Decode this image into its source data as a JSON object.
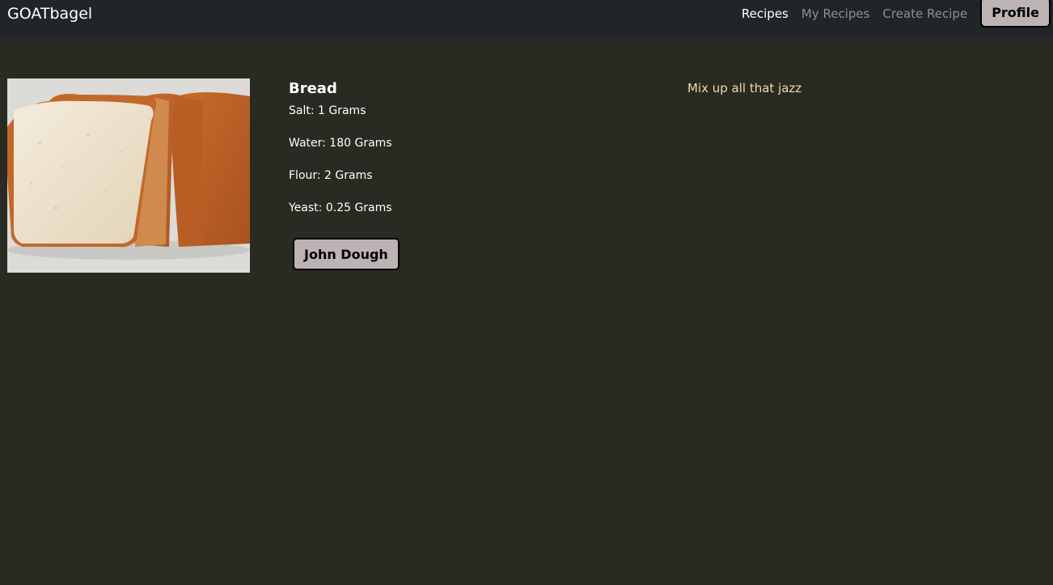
{
  "nav": {
    "brand": "GOATbagel",
    "links": [
      "Recipes",
      "My Recipes",
      "Create Recipe"
    ],
    "profile_label": "Profile"
  },
  "recipe": {
    "title": "Bread",
    "ingredients": [
      "Salt: 1 Grams",
      "Water: 180 Grams",
      "Flour: 2 Grams",
      "Yeast: 0.25 Grams"
    ],
    "author": "John Dough",
    "instructions": "Mix up all that jazz"
  },
  "colors": {
    "background": "#292a22",
    "navbar": "#212529",
    "button": "#bdb3b5",
    "instructions_text": "#f3d9a6"
  }
}
